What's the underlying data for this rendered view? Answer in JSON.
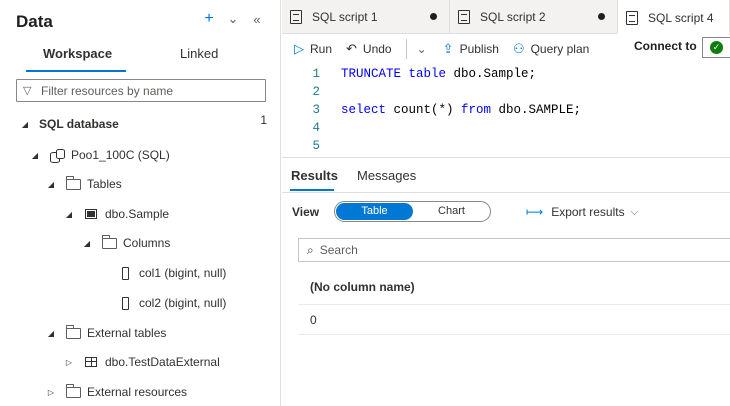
{
  "left": {
    "title": "Data",
    "header_icons": [
      "plus-icon",
      "chevron-double-down-icon",
      "collapse-left-icon"
    ],
    "tabs": [
      "Workspace",
      "Linked"
    ],
    "active_tab": "Workspace",
    "filter_placeholder": "Filter resources by name",
    "section": {
      "label": "SQL database",
      "count": "1"
    },
    "tree": [
      {
        "label": "Poo1_100C (SQL)",
        "icon": "database-icon",
        "expanded": true
      },
      {
        "label": "Tables",
        "icon": "folder-icon",
        "expanded": true
      },
      {
        "label": "dbo.Sample",
        "icon": "table-icon",
        "expanded": true
      },
      {
        "label": "Columns",
        "icon": "folder-icon",
        "expanded": true
      },
      {
        "label": "col1 (bigint, null)",
        "icon": "column-icon"
      },
      {
        "label": "col2 (bigint, null)",
        "icon": "column-icon"
      },
      {
        "label": "External tables",
        "icon": "folder-icon",
        "expanded": true
      },
      {
        "label": "dbo.TestDataExternal",
        "icon": "table-icon",
        "expanded": false
      },
      {
        "label": "External resources",
        "icon": "folder-icon",
        "expanded": false
      }
    ]
  },
  "editor_tabs": [
    {
      "label": "SQL script 1",
      "dirty": true
    },
    {
      "label": "SQL script 2",
      "dirty": true
    },
    {
      "label": "SQL script 4",
      "active": true
    }
  ],
  "toolbar": {
    "run": "Run",
    "undo": "Undo",
    "publish": "Publish",
    "query_plan": "Query plan",
    "connect_to": "Connect to",
    "status_color": "#107c10"
  },
  "editor": {
    "line_numbers": [
      "1",
      "2",
      "3",
      "4",
      "5"
    ],
    "lines": [
      {
        "kw": "TRUNCATE table",
        "rest": " dbo.Sample;"
      },
      {
        "kw": "",
        "rest": ""
      },
      {
        "kw": "select",
        "rest": " count(*) ",
        "kw2": "from",
        "rest2": " dbo.SAMPLE;"
      }
    ]
  },
  "results": {
    "tabs": [
      "Results",
      "Messages"
    ],
    "active_tab": "Results",
    "view_label": "View",
    "view_options": [
      "Table",
      "Chart"
    ],
    "view_selected": "Table",
    "export_label": "Export results",
    "search_placeholder": "Search",
    "columns": [
      "(No column name)"
    ],
    "rows": [
      [
        "0"
      ]
    ]
  },
  "colors": {
    "accent": "#0078d4",
    "keyword": "#0000ff",
    "line_number": "#237893"
  }
}
